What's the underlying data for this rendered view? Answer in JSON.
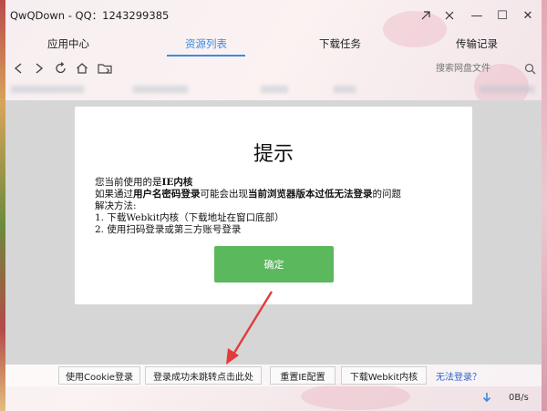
{
  "window": {
    "title": "QwQDown - QQ：1243299385",
    "minimize": "—",
    "restore": "☐",
    "close": "✕"
  },
  "tabs": [
    {
      "label": "应用中心",
      "active": false
    },
    {
      "label": "资源列表",
      "active": true
    },
    {
      "label": "下载任务",
      "active": false
    },
    {
      "label": "传输记录",
      "active": false
    }
  ],
  "navbar": {
    "icons": [
      "back-icon",
      "forward-icon",
      "refresh-icon",
      "home-icon",
      "folder-icon"
    ],
    "search_placeholder": "搜索网盘文件"
  },
  "dialog": {
    "title": "提示",
    "line1_prefix": "您当前使用的是",
    "line1_bold": "IE内核",
    "line2_prefix": "如果通过",
    "line2_bold1": "用户名密码登录",
    "line2_mid": "可能会出现",
    "line2_bold2": "当前浏览器版本过低无法登录",
    "line2_suffix": "的问题",
    "line3": "解决方法:",
    "line4": "1. 下载Webkit内核（下载地址在窗口底部）",
    "line5": "2. 使用扫码登录或第三方账号登录",
    "ok_label": "确定",
    "ok_color": "#5cb85c"
  },
  "bottombar": {
    "buttons": [
      {
        "label": "使用Cookie登录"
      },
      {
        "label": "登录成功未跳转点击此处"
      },
      {
        "label": "重置IE配置"
      },
      {
        "label": "下载Webkit内核"
      }
    ],
    "link": "无法登录？"
  },
  "status": {
    "speed": "0B/s"
  },
  "colors": {
    "accent": "#3b8be0",
    "link": "#2f64c8",
    "annotation": "#e23b3b"
  }
}
